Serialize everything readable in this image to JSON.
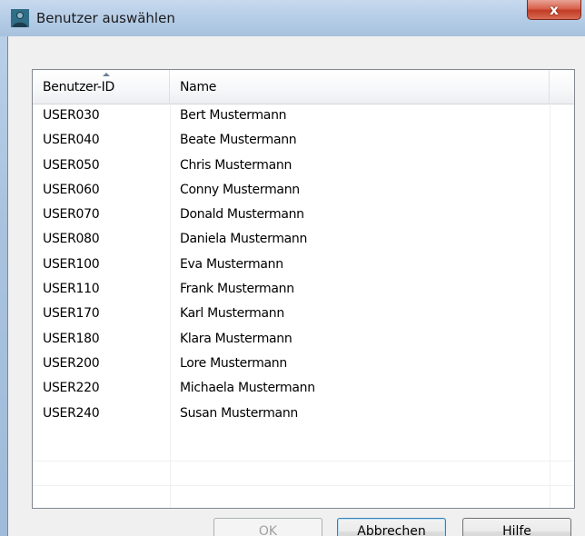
{
  "window": {
    "title": "Benutzer auswählen",
    "close_glyph": "x",
    "icon": "user-icon"
  },
  "list": {
    "columns": [
      "Benutzer-ID",
      "Name"
    ],
    "sort_column": "Benutzer-ID",
    "sort_direction": "ascending",
    "rows": [
      {
        "id": "USER030",
        "name": "Bert Mustermann"
      },
      {
        "id": "USER040",
        "name": "Beate Mustermann"
      },
      {
        "id": "USER050",
        "name": "Chris Mustermann"
      },
      {
        "id": "USER060",
        "name": "Conny Mustermann"
      },
      {
        "id": "USER070",
        "name": "Donald Mustermann"
      },
      {
        "id": "USER080",
        "name": "Daniela Mustermann"
      },
      {
        "id": "USER100",
        "name": "Eva Mustermann"
      },
      {
        "id": "USER110",
        "name": "Frank Mustermann"
      },
      {
        "id": "USER170",
        "name": "Karl Mustermann"
      },
      {
        "id": "USER180",
        "name": "Klara Mustermann"
      },
      {
        "id": "USER200",
        "name": "Lore Mustermann"
      },
      {
        "id": "USER220",
        "name": "Michaela Mustermann"
      },
      {
        "id": "USER240",
        "name": "Susan Mustermann"
      }
    ]
  },
  "buttons": {
    "ok": "OK",
    "cancel": "Abbrechen",
    "help_first": "H",
    "help_rest": "ilfe"
  }
}
